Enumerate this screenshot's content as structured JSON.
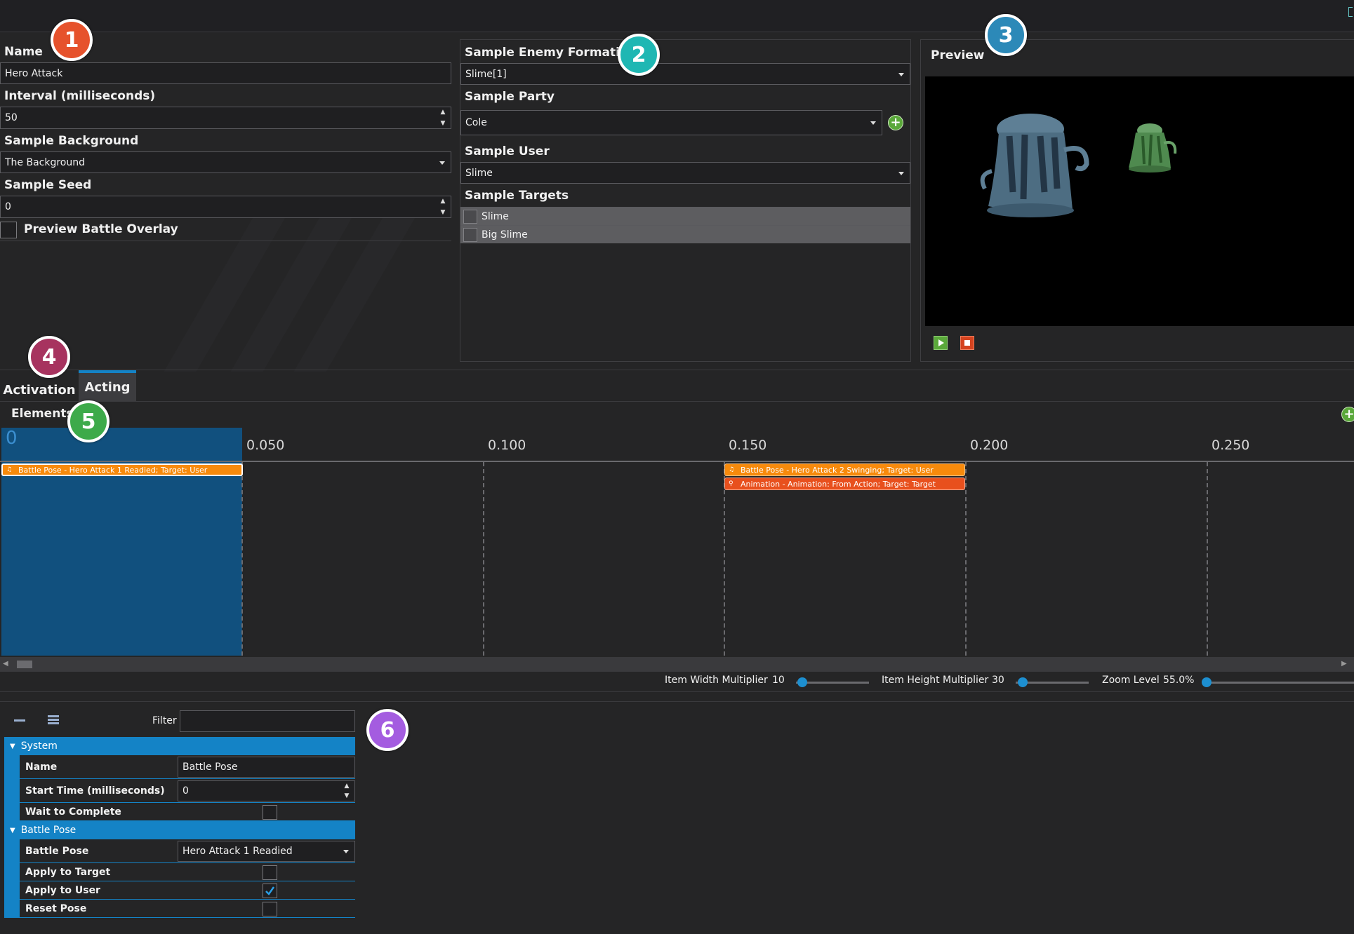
{
  "colors": {
    "badge1": "#e6522c",
    "badge2": "#1fb7b3",
    "badge3": "#2c89b8",
    "badge4": "#a7335f",
    "badge5": "#3daa4a",
    "badge6": "#a45ce0",
    "accent_blue": "#1483c6",
    "bar_orange": "#f78a0c",
    "bar_red": "#e8501d"
  },
  "badges": [
    "1",
    "2",
    "3",
    "4",
    "5",
    "6"
  ],
  "general": {
    "name_label": "Name",
    "name_value": "Hero Attack",
    "interval_label": "Interval (milliseconds)",
    "interval_value": "50",
    "background_label": "Sample Background",
    "background_value": "The Background",
    "seed_label": "Sample Seed",
    "seed_value": "0",
    "overlay_label": "Preview Battle Overlay"
  },
  "sample": {
    "formation_label": "Sample Enemy Formation",
    "formation_value": "Slime[1]",
    "party_label": "Sample Party",
    "party_value": "Cole",
    "user_label": "Sample User",
    "user_value": "Slime",
    "targets_label": "Sample Targets",
    "targets": [
      "Slime",
      "Big Slime"
    ]
  },
  "preview": {
    "title": "Preview",
    "icons": [
      "play-icon",
      "stop-icon",
      "slime-sprite-large",
      "slime-sprite-small"
    ]
  },
  "tabs": [
    {
      "label": "Activation",
      "active": false
    },
    {
      "label": "Acting",
      "active": true
    }
  ],
  "elements": {
    "title": "Elements",
    "start_marker": "0",
    "ticks": [
      "0.050",
      "0.100",
      "0.150",
      "0.200",
      "0.250"
    ],
    "bars": [
      {
        "text": "Battle Pose - Hero Attack 1 Readied; Target: User",
        "icon": "♫"
      },
      {
        "text": "Battle Pose - Hero Attack 2 Swinging; Target: User",
        "icon": "♫"
      },
      {
        "text": "Animation - Animation: From Action; Target: Target",
        "icon": "⚲"
      }
    ]
  },
  "zoom_controls": {
    "width_label": "Item Width Multiplier",
    "width_value": "10",
    "height_label": "Item Height Multiplier",
    "height_value": "30",
    "zoom_label": "Zoom Level",
    "zoom_value": "55.0%"
  },
  "properties": {
    "filter_label": "Filter",
    "filter_value": "",
    "system_header": "System",
    "name_label": "Name",
    "name_value": "Battle Pose",
    "start_label": "Start Time (milliseconds)",
    "start_value": "0",
    "wait_label": "Wait to Complete",
    "pose_header": "Battle Pose",
    "pose_label": "Battle Pose",
    "pose_value": "Hero Attack 1 Readied",
    "apply_target_label": "Apply to Target",
    "apply_user_label": "Apply to User",
    "reset_label": "Reset Pose",
    "apply_user_checked": true
  }
}
